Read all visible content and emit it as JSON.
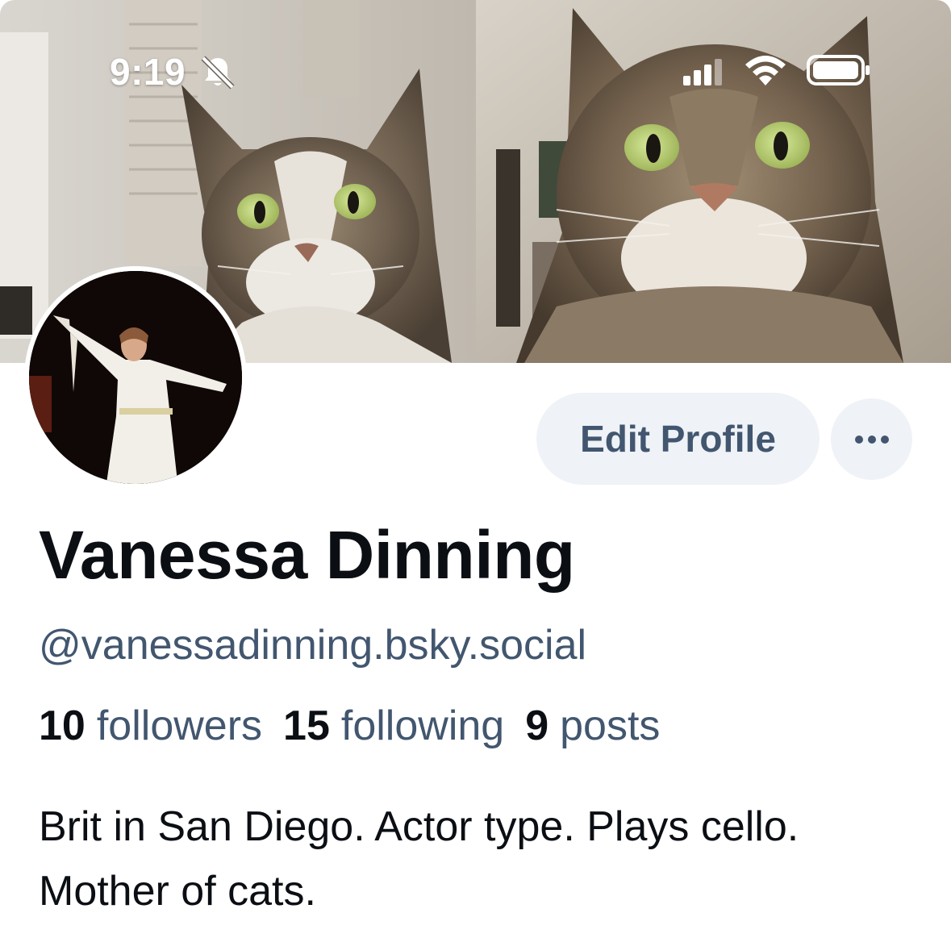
{
  "status_bar": {
    "time": "9:19",
    "icons": [
      "bell-slash-icon",
      "cellular-signal-icon",
      "wifi-icon",
      "battery-icon"
    ]
  },
  "banner": {
    "description_icon": "cat-photo-banner"
  },
  "avatar": {
    "icon": "profile-photo"
  },
  "actions": {
    "edit_profile_label": "Edit Profile",
    "more_label": "···"
  },
  "profile": {
    "display_name": "Vanessa Dinning",
    "handle": "@vanessadinning.bsky.social",
    "stats": {
      "followers_count": "10",
      "followers_label": "followers",
      "following_count": "15",
      "following_label": "following",
      "posts_count": "9",
      "posts_label": "posts"
    },
    "bio": "Brit in San Diego. Actor type. Plays cello. Mother of cats."
  },
  "colors": {
    "text_primary": "#0b0f14",
    "text_secondary": "#42566f",
    "button_bg": "#eff2f6"
  }
}
